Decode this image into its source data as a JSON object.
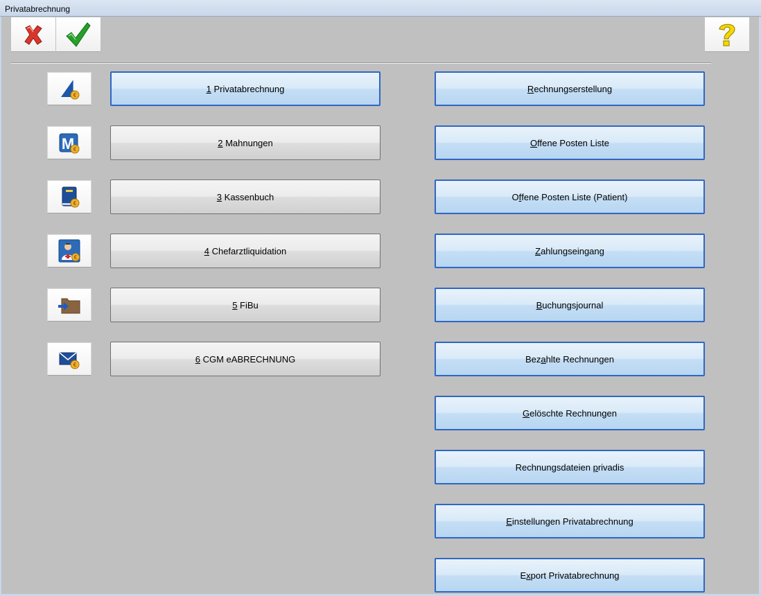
{
  "window": {
    "title": "Privatabrechnung"
  },
  "toolbar": {
    "cancel_icon": "red-x-icon",
    "ok_icon": "green-check-icon",
    "help_icon": "yellow-question-icon"
  },
  "left_menu": [
    {
      "key": "1",
      "label": " Privatabrechnung",
      "icon": "document-euro-icon"
    },
    {
      "key": "2",
      "label": " Mahnungen",
      "icon": "mahnung-m-euro-icon"
    },
    {
      "key": "3",
      "label": " Kassenbuch",
      "icon": "cashbook-euro-icon"
    },
    {
      "key": "4",
      "label": " Chefarztliquidation",
      "icon": "doctor-euro-icon"
    },
    {
      "key": "5",
      "label": " FiBu",
      "icon": "folder-arrow-icon"
    },
    {
      "key": "6",
      "label": " CGM eABRECHNUNG",
      "icon": "envelope-euro-icon"
    }
  ],
  "right_menu": [
    {
      "pre": "",
      "u": "R",
      "post": "echnungserstellung"
    },
    {
      "pre": "",
      "u": "O",
      "post": "ffene Posten Liste"
    },
    {
      "pre": "O",
      "u": "f",
      "post": "fene Posten Liste (Patient)"
    },
    {
      "pre": "",
      "u": "Z",
      "post": "ahlungseingang"
    },
    {
      "pre": "",
      "u": "B",
      "post": "uchungsjournal"
    },
    {
      "pre": "Bez",
      "u": "a",
      "post": "hlte Rechnungen"
    },
    {
      "pre": "",
      "u": "G",
      "post": "elöschte Rechnungen"
    },
    {
      "pre": "Rechnungsdateien ",
      "u": "p",
      "post": "rivadis"
    },
    {
      "pre": "",
      "u": "E",
      "post": "instellungen Privatabrechnung"
    },
    {
      "pre": "E",
      "u": "x",
      "post": "port Privatabrechnung"
    }
  ]
}
